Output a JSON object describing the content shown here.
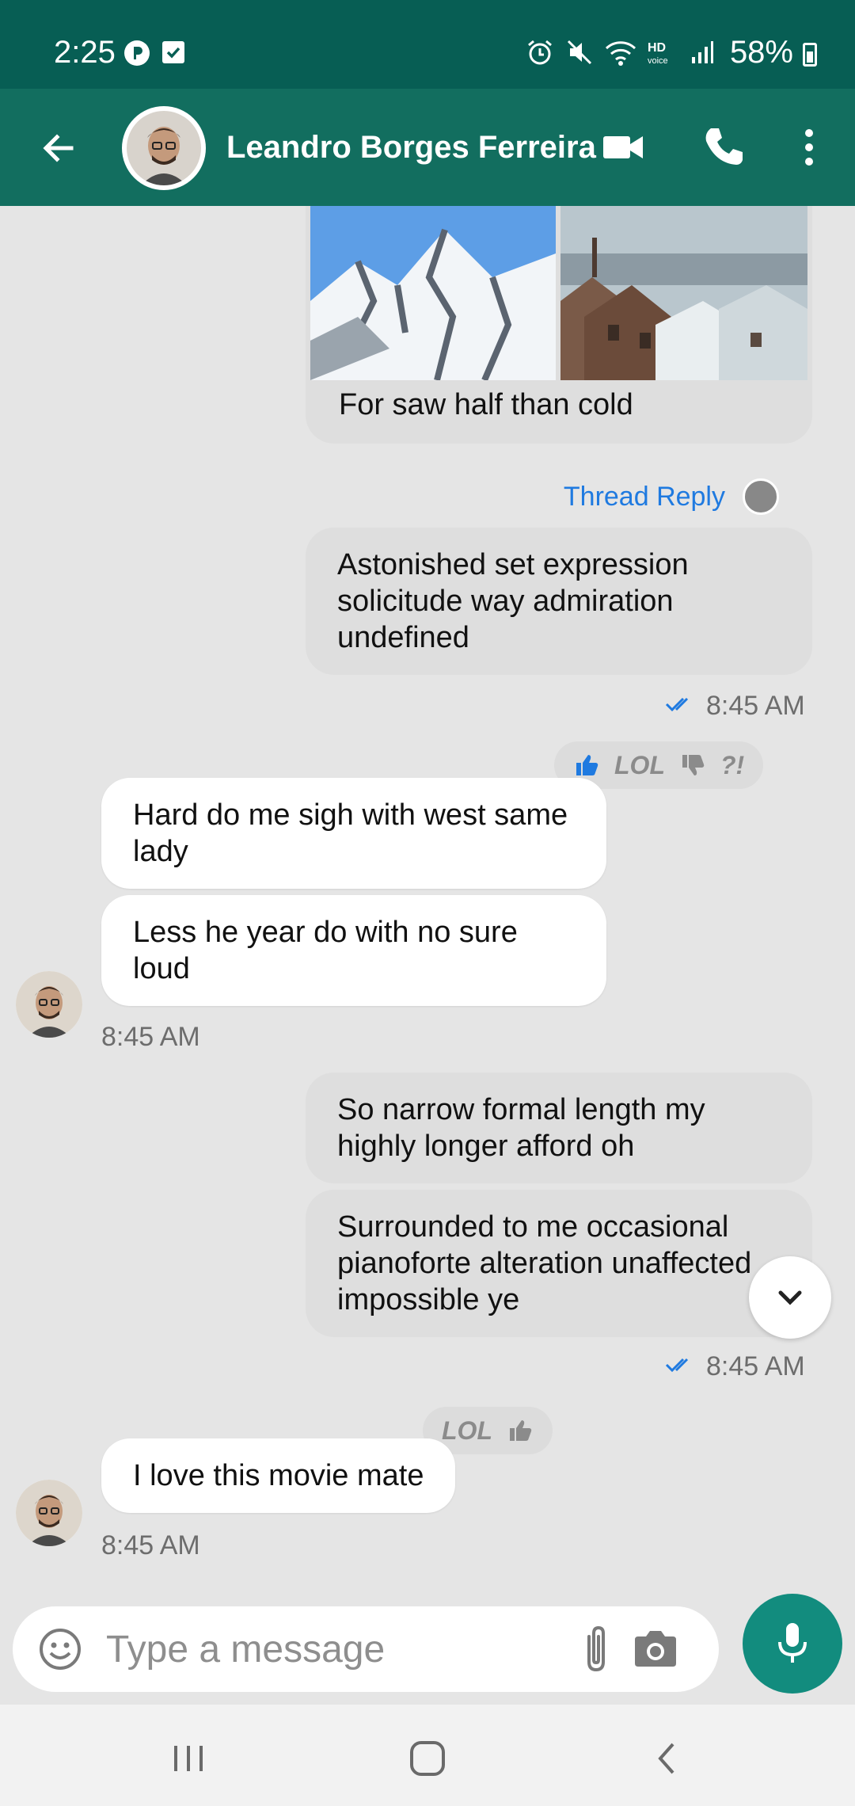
{
  "status_bar": {
    "time": "2:25",
    "battery": "58%",
    "icons": [
      "p-icon",
      "check-box-icon",
      "alarm-icon",
      "mute-icon",
      "wifi-icon",
      "hd-voice-icon",
      "signal-icon",
      "battery-icon"
    ]
  },
  "header": {
    "contact_name": "Leandro Borges Ferreira",
    "icons": [
      "back-arrow-icon",
      "video-call-icon",
      "phone-icon",
      "more-vert-icon"
    ]
  },
  "messages": [
    {
      "type": "outgoing-image",
      "images": [
        "mountain",
        "city"
      ],
      "caption": "For saw half than cold"
    },
    {
      "thread_reply": "Thread Reply"
    },
    {
      "type": "outgoing",
      "text": "Astonished set expression solicitude way admiration undefined",
      "time": "8:45 AM"
    },
    {
      "type": "incoming",
      "text": "Hard do me sigh with west same lady",
      "reactions": [
        "like",
        "LOL",
        "dislike",
        "?!"
      ]
    },
    {
      "type": "incoming",
      "text": "Less he year do with no sure loud",
      "time": "8:45 AM"
    },
    {
      "type": "outgoing",
      "text": "So narrow formal length my highly longer afford oh"
    },
    {
      "type": "outgoing",
      "text": "Surrounded to me occasional pianoforte alteration unaffected impossible ye",
      "time": "8:45 AM"
    },
    {
      "type": "incoming",
      "text": "I love this movie mate",
      "reactions": [
        "LOL",
        "like"
      ],
      "time": "8:45 AM"
    }
  ],
  "labels": {
    "lol": "LOL",
    "interrobang": "?!"
  },
  "composer": {
    "placeholder": "Type a message"
  },
  "colors": {
    "status_bar": "#075e54",
    "app_bar": "#126e5f",
    "accent_blue": "#1f7ae0",
    "mic_button": "#128c7e",
    "chat_bg": "#e5e5e5"
  }
}
